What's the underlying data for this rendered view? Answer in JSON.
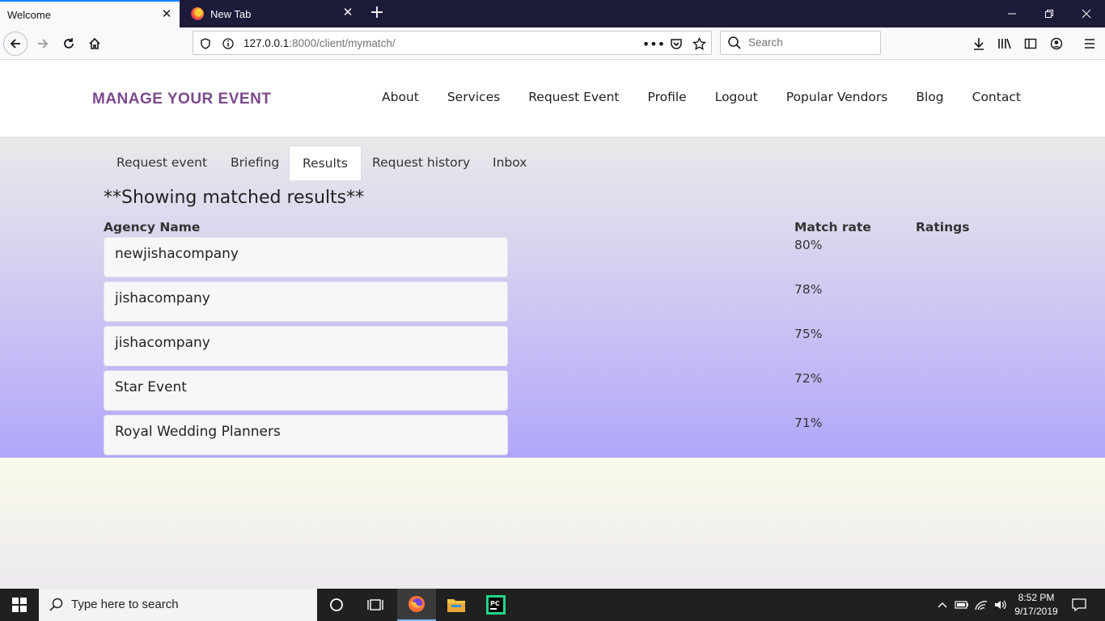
{
  "browser": {
    "tabs": [
      {
        "title": "Welcome",
        "active": true
      },
      {
        "title": "New Tab",
        "active": false
      }
    ],
    "url_host": "127.0.0.1",
    "url_rest": ":8000/client/mymatch/",
    "search_placeholder": "Search"
  },
  "site": {
    "brand": "MANAGE YOUR EVENT",
    "nav": [
      "About",
      "Services",
      "Request Event",
      "Profile",
      "Logout",
      "Popular Vendors",
      "Blog",
      "Contact"
    ],
    "brand_color": "#7b4a8b"
  },
  "subtabs": [
    {
      "label": "Request event",
      "active": false
    },
    {
      "label": "Briefing",
      "active": false
    },
    {
      "label": "Results",
      "active": true
    },
    {
      "label": "Request history",
      "active": false
    },
    {
      "label": "Inbox",
      "active": false
    }
  ],
  "results": {
    "title": "**Showing matched results**",
    "col_agency": "Agency Name",
    "col_match": "Match rate",
    "col_ratings": "Ratings",
    "rows": [
      {
        "agency": "newjishacompany",
        "match": "80%"
      },
      {
        "agency": "jishacompany",
        "match": "78%"
      },
      {
        "agency": "jishacompany",
        "match": "75%"
      },
      {
        "agency": "Star Event",
        "match": "72%"
      },
      {
        "agency": "Royal Wedding Planners",
        "match": "71%"
      }
    ]
  },
  "taskbar": {
    "search_placeholder": "Type here to search",
    "time": "8:52 PM",
    "date": "9/17/2019"
  }
}
